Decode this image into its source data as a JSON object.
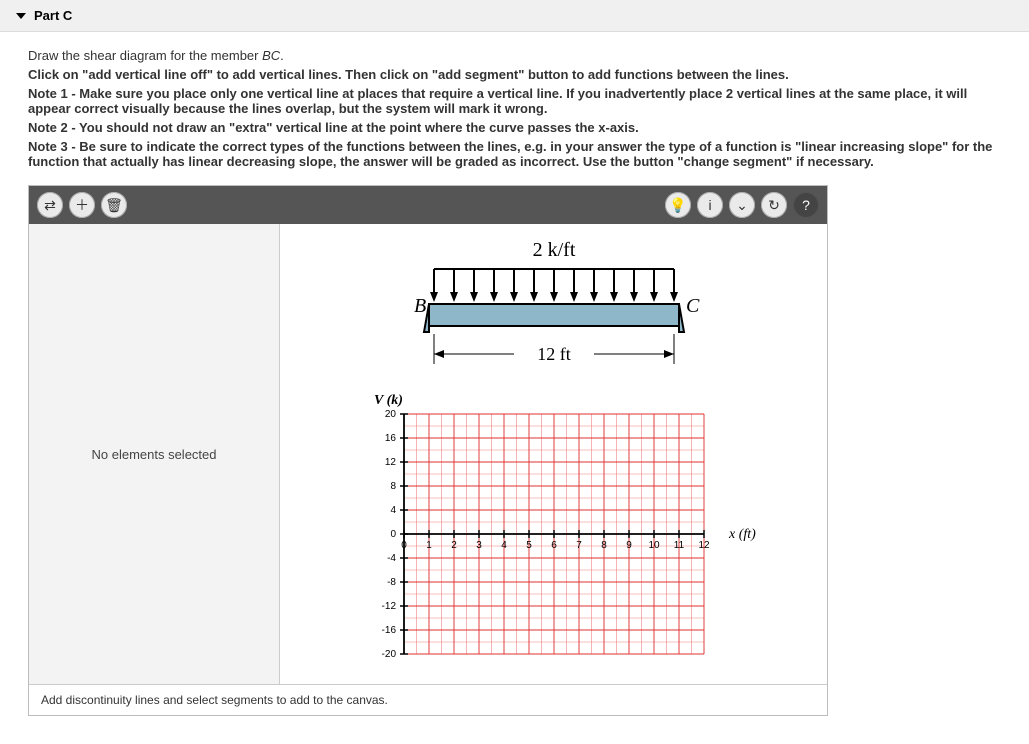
{
  "header": {
    "title": "Part C"
  },
  "prompt": {
    "line1_pre": "Draw the shear diagram for the member ",
    "line1_ital": "BC",
    "line1_post": "."
  },
  "instructions": {
    "l1": "Click on \"add vertical line off\" to add vertical lines. Then click on \"add segment\" button to add functions between the lines.",
    "l2": "Note 1 - Make sure you place only one vertical line at places that require a vertical line. If you inadvertently place 2 vertical lines at the same place, it will appear correct visually because the lines overlap, but the system will mark it wrong.",
    "l3": "Note 2 - You should not draw an \"extra\" vertical line at the point where the curve passes the x-axis.",
    "l4": "Note 3 - Be sure to indicate the correct types of the functions between the lines, e.g. in your answer the type of a function is \"linear increasing slope\" for the function that actually has linear decreasing slope, the answer will be graded as incorrect. Use the button \"change segment\" if necessary."
  },
  "toolbar": {
    "left": [
      {
        "name": "arrows-icon",
        "glyph": "⇄"
      },
      {
        "name": "add-icon",
        "glyph": "＋"
      },
      {
        "name": "delete-icon",
        "glyph": "🗑"
      }
    ],
    "right": [
      {
        "name": "bulb-icon",
        "glyph": "💡"
      },
      {
        "name": "info-icon",
        "glyph": "i"
      },
      {
        "name": "dropdown-icon",
        "glyph": "⌄"
      },
      {
        "name": "reset-icon",
        "glyph": "↻"
      },
      {
        "name": "help-icon",
        "glyph": "?"
      }
    ]
  },
  "side": {
    "message": "No elements selected"
  },
  "figure": {
    "load_label": "2 k/ft",
    "left_label": "B",
    "right_label": "C",
    "span_label": "12 ft"
  },
  "chart_data": {
    "type": "line",
    "title": "",
    "xlabel": "x (ft)",
    "ylabel": "V (k)",
    "xlim": [
      0,
      12
    ],
    "ylim": [
      -20,
      20
    ],
    "x_ticks": [
      0,
      1,
      2,
      3,
      4,
      5,
      6,
      7,
      8,
      9,
      10,
      11,
      12
    ],
    "y_ticks": [
      -20,
      -16,
      -12,
      -8,
      -4,
      0,
      4,
      8,
      12,
      16,
      20
    ],
    "series": []
  },
  "footer": {
    "hint": "Add discontinuity lines and select segments to add to the canvas."
  }
}
